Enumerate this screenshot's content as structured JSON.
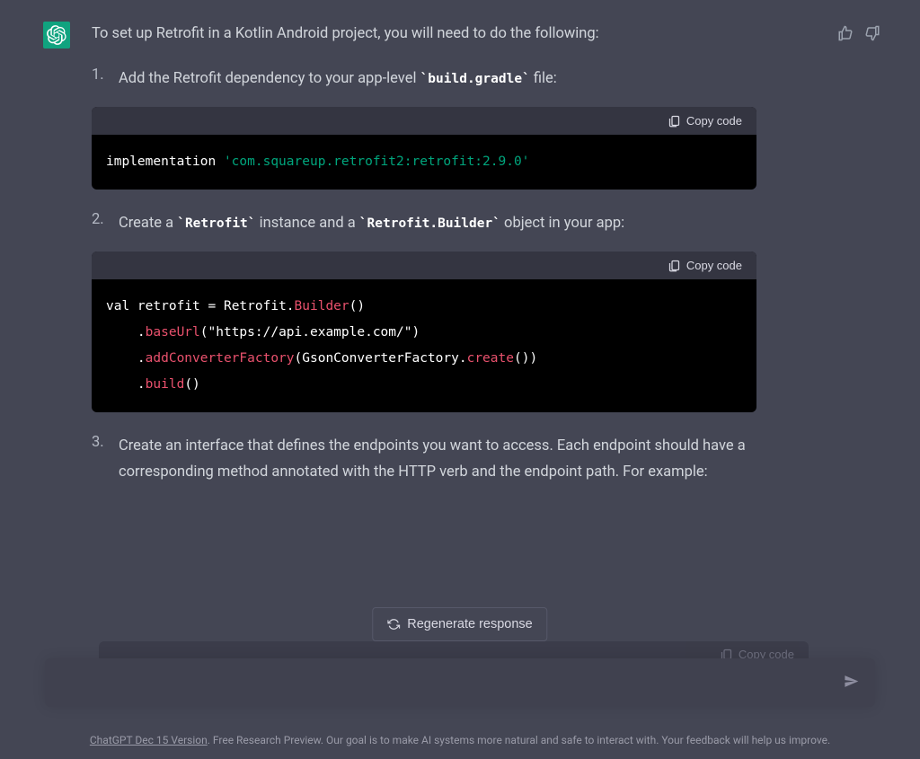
{
  "message": {
    "intro": "To set up Retrofit in a Kotlin Android project, you will need to do the following:",
    "steps": [
      {
        "text_parts": [
          "Add the Retrofit dependency to your app-level ",
          "build.gradle",
          " file:"
        ],
        "code_header_copy": "Copy code",
        "code": {
          "line1_kw": "implementation",
          "line1_str": "'com.squareup.retrofit2:retrofit:2.9.0'"
        }
      },
      {
        "text_parts": [
          "Create a ",
          "Retrofit",
          " instance and a ",
          "Retrofit.Builder",
          " object in your app:"
        ],
        "code_header_copy": "Copy code",
        "code": {
          "l1a": "val",
          "l1b": " retrofit = Retrofit.",
          "l1c": "Builder",
          "l1d": "()",
          "l2a": "    .",
          "l2b": "baseUrl",
          "l2c": "(",
          "l2d": "\"https://api.example.com/\"",
          "l2e": ")",
          "l3a": "    .",
          "l3b": "addConverterFactory",
          "l3c": "(GsonConverterFactory.",
          "l3d": "create",
          "l3e": "())",
          "l4a": "    .",
          "l4b": "build",
          "l4c": "()"
        }
      },
      {
        "text": "Create an interface that defines the endpoints you want to access. Each endpoint should have a corresponding method annotated with the HTTP verb and the endpoint path. For example:",
        "code_header_copy": "Copy code"
      }
    ]
  },
  "regenerate_label": "Regenerate response",
  "input_placeholder": "",
  "footer": {
    "link": "ChatGPT Dec 15 Version",
    "text": ". Free Research Preview. Our goal is to make AI systems more natural and safe to interact with. Your feedback will help us improve."
  }
}
